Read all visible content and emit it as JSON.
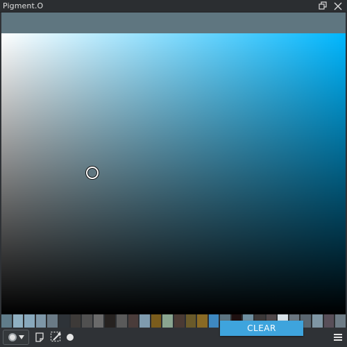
{
  "window": {
    "title": "Pigment.O",
    "icons": [
      "restore-icon",
      "close-icon"
    ]
  },
  "colors": {
    "current": "#5f7680",
    "gradient_white": "#ffffff",
    "gradient_hue": "#00b7ff",
    "accent": "#3ea4dd"
  },
  "palette": [
    "#607c8a",
    "#8fb0c2",
    "#88a8bc",
    "#7e97a8",
    "#6a7a86",
    "#2e3338",
    "#3d3a38",
    "#505050",
    "#6a6a6a",
    "#262220",
    "#5a5a5a",
    "#4a3c3a",
    "#7f9bae",
    "#7a5c1c",
    "#8aa590",
    "#4a3a34",
    "#6a5a2a",
    "#8a6a24",
    "#3e88c0",
    "#5c7480",
    "#1e1010",
    "#6f8fa0",
    "#3c3838",
    "#50484a",
    "#d8e2e8",
    "#6a7680",
    "#5a6670",
    "#7f96a4",
    "#584e58",
    "#6e7c86"
  ],
  "toolbar": {
    "clear_label": "CLEAR",
    "icons": [
      "color-mode-icon",
      "note-icon",
      "eyedropper-selection-icon",
      "dot-icon",
      "menu-icon"
    ]
  }
}
